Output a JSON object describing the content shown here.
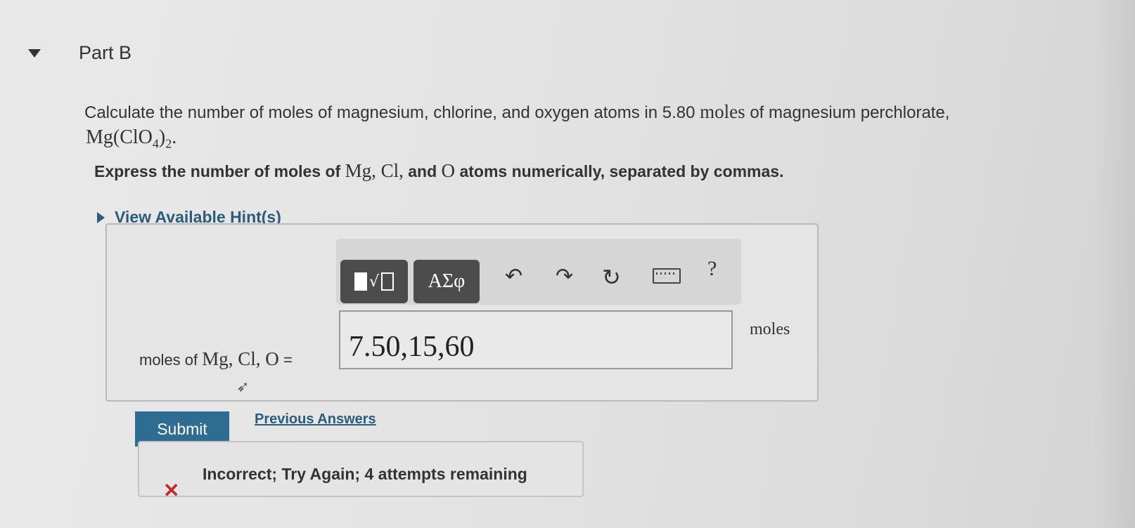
{
  "part": {
    "title": "Part B"
  },
  "question": {
    "text_before": "Calculate the number of moles of magnesium, chlorine, and oxygen atoms in 5.80",
    "unit_moles": "moles",
    "text_after": "of magnesium perchlorate,",
    "formula_main": "Mg(ClO",
    "formula_sub": "4",
    "formula_close": ")",
    "formula_sub2": "2",
    "formula_end": "."
  },
  "instruction": {
    "prefix": "Express the number of moles of",
    "symbols": "Mg, Cl,",
    "and": "and",
    "o_symbol": "O",
    "suffix": "atoms numerically, separated by commas."
  },
  "hints": {
    "label": "View Available Hint(s)"
  },
  "toolbar": {
    "symbols_label": "ΑΣφ",
    "undo_glyph": "↶",
    "redo_glyph": "↷",
    "reset_glyph": "↻",
    "help_label": "?"
  },
  "answer": {
    "label_prefix": "moles of",
    "label_symbols": "Mg, Cl, O",
    "label_equals": "=",
    "value": "7.50,15,60",
    "unit": "moles"
  },
  "actions": {
    "submit_label": "Submit",
    "previous_answers_label": "Previous Answers"
  },
  "feedback": {
    "icon": "✕",
    "text": "Incorrect; Try Again; 4 attempts remaining"
  }
}
